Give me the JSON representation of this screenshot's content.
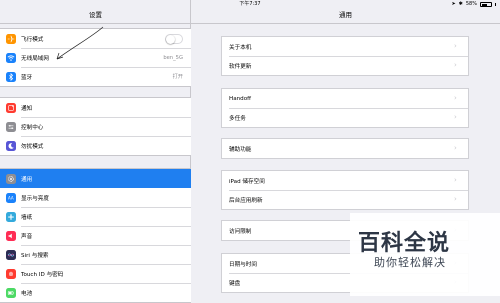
{
  "status_bar": {
    "device": "iPad",
    "time": "下午7:37",
    "battery": "58%",
    "battery_level": 0.58
  },
  "left_pane": {
    "title": "设置",
    "groups": [
      [
        {
          "label": "飞行模式",
          "icon": "airplane-icon",
          "color": "#ff9500",
          "toggle": false
        },
        {
          "label": "无线局域网",
          "icon": "wifi-icon",
          "color": "#1a82fb",
          "value": "ben_5G"
        },
        {
          "label": "蓝牙",
          "icon": "bluetooth-icon",
          "color": "#1a82fb",
          "value": "打开"
        }
      ],
      [
        {
          "label": "通知",
          "icon": "notifications-icon",
          "color": "#ff3b30"
        },
        {
          "label": "控制中心",
          "icon": "control-center-icon",
          "color": "#8e8e93"
        },
        {
          "label": "勿扰模式",
          "icon": "moon-icon",
          "color": "#5856d6"
        }
      ],
      [
        {
          "label": "通用",
          "icon": "gear-icon",
          "color": "#8e8e93",
          "selected": true
        },
        {
          "label": "显示与亮度",
          "icon": "display-icon",
          "color": "#1a82fb"
        },
        {
          "label": "墙纸",
          "icon": "wallpaper-icon",
          "color": "#34aadc"
        },
        {
          "label": "声音",
          "icon": "sound-icon",
          "color": "#ff2d55"
        },
        {
          "label": "Siri 与搜索",
          "icon": "siri-icon",
          "color": "#2c2c54"
        },
        {
          "label": "Touch ID 与密码",
          "icon": "fingerprint-icon",
          "color": "#ff3b30"
        },
        {
          "label": "电池",
          "icon": "battery-icon",
          "color": "#4cd964"
        }
      ]
    ]
  },
  "right_pane": {
    "title": "通用",
    "groups": [
      [
        "关于本机",
        "软件更新"
      ],
      [
        "Handoff",
        "多任务"
      ],
      [
        "辅助功能"
      ],
      [
        "iPad 储存空间",
        "后台应用刷新"
      ],
      [
        "访问限制"
      ],
      [
        "日期与时间",
        "键盘"
      ]
    ]
  },
  "watermark": {
    "title": "百科全说",
    "subtitle": "助你轻松解决"
  }
}
